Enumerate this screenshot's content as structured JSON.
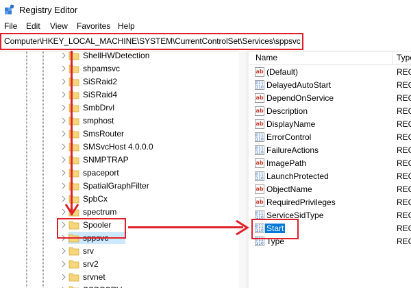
{
  "window": {
    "title": "Registry Editor"
  },
  "menu": [
    "File",
    "Edit",
    "View",
    "Favorites",
    "Help"
  ],
  "address": "Computer\\HKEY_LOCAL_MACHINE\\SYSTEM\\CurrentControlSet\\Services\\sppsvc",
  "tree": [
    "ShellHWDetection",
    "shpamsvc",
    "SiSRaid2",
    "SiSRaid4",
    "SmbDrvl",
    "smphost",
    "SmsRouter",
    "SMSvcHost 4.0.0.0",
    "SNMPTRAP",
    "spaceport",
    "SpatialGraphFilter",
    "SpbCx",
    "spectrum",
    "Spooler",
    "sppsvc",
    "srv",
    "srv2",
    "srvnet",
    "SSDPSRV"
  ],
  "tree_selected": "sppsvc",
  "values_header": {
    "name": "Name",
    "type": "Type"
  },
  "values": [
    {
      "name": "(Default)",
      "icon": "string-value-icon",
      "type": "REG"
    },
    {
      "name": "DelayedAutoStart",
      "icon": "binary-value-icon",
      "type": "REG"
    },
    {
      "name": "DependOnService",
      "icon": "string-value-icon",
      "type": "REG"
    },
    {
      "name": "Description",
      "icon": "string-value-icon",
      "type": "REG"
    },
    {
      "name": "DisplayName",
      "icon": "string-value-icon",
      "type": "REG"
    },
    {
      "name": "ErrorControl",
      "icon": "binary-value-icon",
      "type": "REG"
    },
    {
      "name": "FailureActions",
      "icon": "binary-value-icon",
      "type": "REG"
    },
    {
      "name": "ImagePath",
      "icon": "string-value-icon",
      "type": "REG"
    },
    {
      "name": "LaunchProtected",
      "icon": "binary-value-icon",
      "type": "REG"
    },
    {
      "name": "ObjectName",
      "icon": "string-value-icon",
      "type": "REG"
    },
    {
      "name": "RequiredPrivileges",
      "icon": "string-value-icon",
      "type": "REG"
    },
    {
      "name": "ServiceSidType",
      "icon": "binary-value-icon",
      "type": "REG"
    },
    {
      "name": "Start",
      "icon": "binary-value-icon",
      "type": "REG"
    },
    {
      "name": "Type",
      "icon": "binary-value-icon",
      "type": "REG"
    }
  ],
  "values_selected": "Start",
  "colors": {
    "annotation": "#e0202a",
    "selection": "#0078d7",
    "folder": "#f5d67a"
  }
}
